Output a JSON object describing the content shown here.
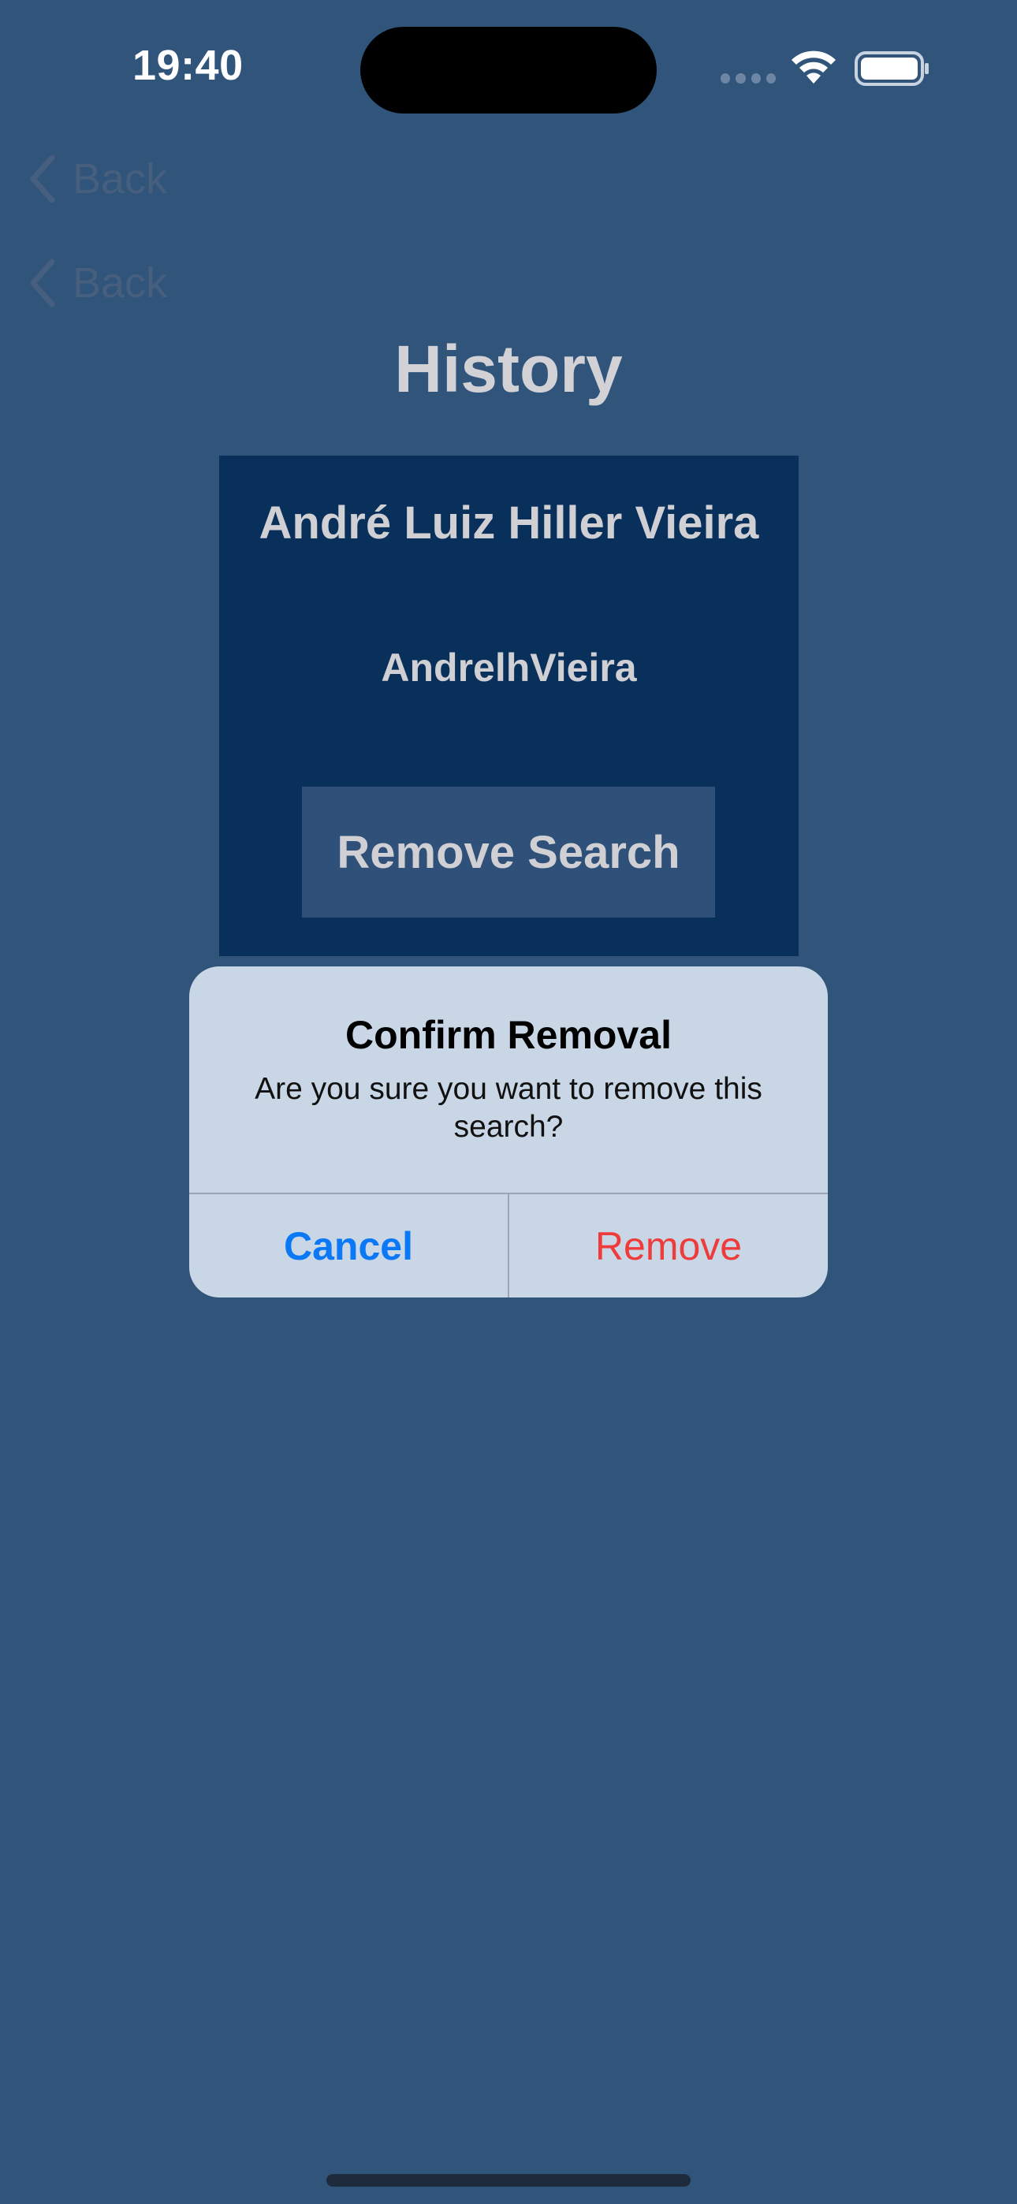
{
  "status_bar": {
    "time": "19:40",
    "icons": [
      "signal-icon",
      "wifi-icon",
      "battery-icon"
    ]
  },
  "nav": {
    "back_buttons": [
      {
        "label": "Back"
      },
      {
        "label": "Back"
      }
    ]
  },
  "page": {
    "title": "History"
  },
  "card": {
    "name": "André Luiz Hiller Vieira",
    "username": "AndrelhVieira",
    "remove_button_label": "Remove Search"
  },
  "alert": {
    "title": "Confirm Removal",
    "message": "Are you sure you want to remove this search?",
    "cancel_label": "Cancel",
    "remove_label": "Remove"
  },
  "colors": {
    "background": "#31547b",
    "card": "#08305b",
    "alert": "#c9d6e5",
    "cancel": "#0b78f5",
    "remove": "#ee3b3b"
  }
}
